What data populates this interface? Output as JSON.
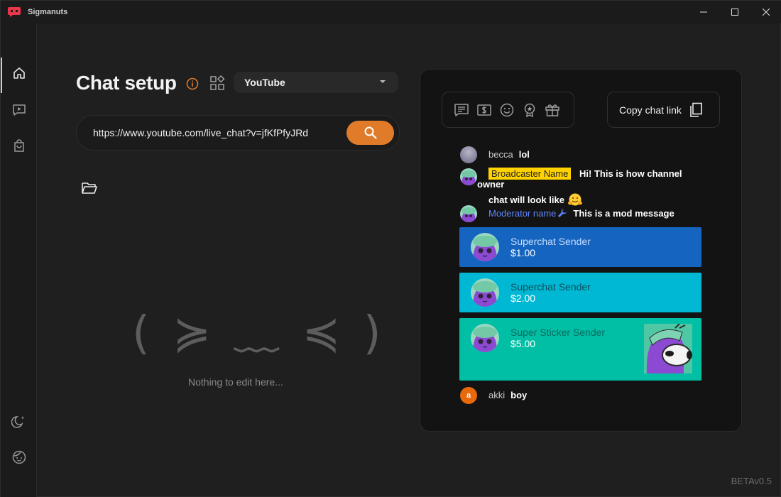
{
  "app": {
    "title": "Sigmanuts",
    "version": "BETAv0.5"
  },
  "window_controls": [
    "minimize",
    "maximize",
    "close"
  ],
  "sidebar": {
    "items": [
      {
        "name": "home",
        "icon": "home-icon",
        "active": true
      },
      {
        "name": "video",
        "icon": "video-chat-icon",
        "active": false
      },
      {
        "name": "store",
        "icon": "shopping-bag-icon",
        "active": false
      }
    ],
    "bottom": [
      {
        "name": "theme",
        "icon": "moon-icon"
      },
      {
        "name": "profile",
        "icon": "face-icon"
      }
    ]
  },
  "setup": {
    "title": "Chat setup",
    "platform": "YouTube",
    "url": "https://www.youtube.com/live_chat?v=jfKfPfyJRd",
    "empty_face": "( ≽ ﹏ ≼ )",
    "empty_text": "Nothing to edit here..."
  },
  "preview": {
    "filters": [
      "chat-icon",
      "dollar-icon",
      "smile-icon",
      "award-icon",
      "gift-icon"
    ],
    "copy_label": "Copy chat link",
    "messages": [
      {
        "author": "becca",
        "text": "lol"
      },
      {
        "author": "Broadcaster Name",
        "text": "Hi! This is how channel owner",
        "text2": "chat will look like"
      },
      {
        "author": "Moderator name",
        "text": "This is a mod message"
      },
      {
        "author": "akki",
        "text": "boy",
        "initial": "a"
      }
    ],
    "superchats": [
      {
        "name": "Superchat Sender",
        "amount": "$1.00",
        "color": "#1565c0",
        "name_color": "#c8dcff"
      },
      {
        "name": "Superchat Sender",
        "amount": "$2.00",
        "color": "#00b8d4",
        "name_color": "#0d4f5a"
      },
      {
        "name": "Super Sticker Sender",
        "amount": "$5.00",
        "color": "#00bfa5",
        "name_color": "#0b6a5d"
      }
    ]
  }
}
